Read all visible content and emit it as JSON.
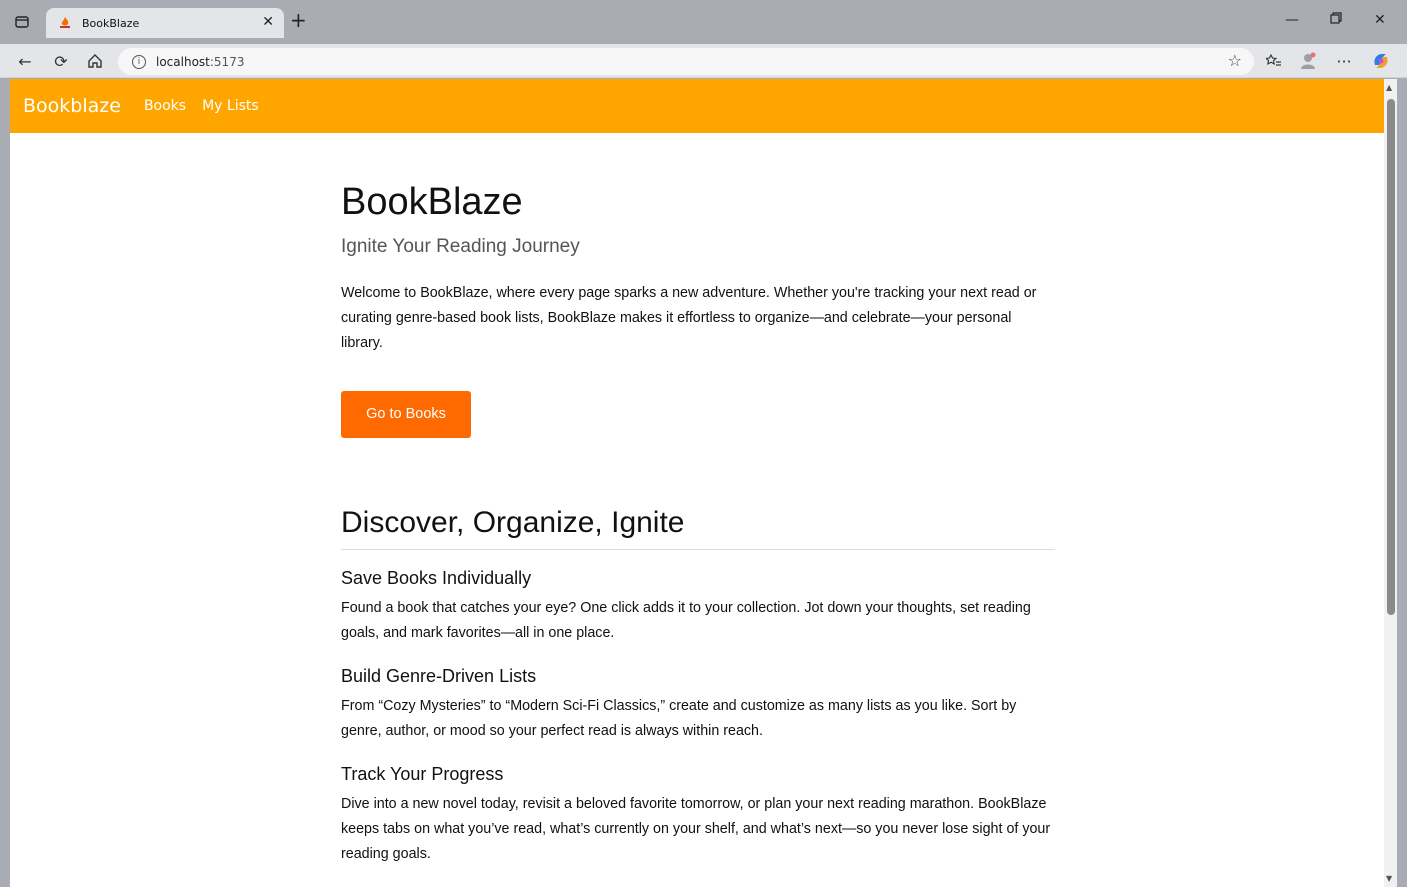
{
  "browser": {
    "tab_title": "BookBlaze",
    "url_host": "localhost",
    "url_port": ":5173"
  },
  "nav": {
    "brand": "Bookblaze",
    "links": [
      "Books",
      "My Lists"
    ]
  },
  "hero": {
    "title": "BookBlaze",
    "tagline": "Ignite Your Reading Journey",
    "intro": "Welcome to BookBlaze, where every page sparks a new adventure. Whether you're tracking your next read or curating genre-based book lists, BookBlaze makes it effortless to organize—and celebrate—your personal library.",
    "cta_label": "Go to Books"
  },
  "features": {
    "heading": "Discover, Organize, Ignite",
    "items": [
      {
        "title": "Save Books Individually",
        "body": "Found a book that catches your eye? One click adds it to your collection. Jot down your thoughts, set reading goals, and mark favorites—all in one place."
      },
      {
        "title": "Build Genre-Driven Lists",
        "body": "From “Cozy Mysteries” to “Modern Sci-Fi Classics,” create and customize as many lists as you like. Sort by genre, author, or mood so your perfect read is always within reach."
      },
      {
        "title": "Track Your Progress",
        "body": "Dive into a new novel today, revisit a beloved favorite tomorrow, or plan your next reading marathon. BookBlaze keeps tabs on what you’ve read, what’s currently on your shelf, and what’s next—so you never lose sight of your reading goals."
      }
    ]
  },
  "colors": {
    "navbar": "#ffa500",
    "cta": "#ff6a00"
  }
}
